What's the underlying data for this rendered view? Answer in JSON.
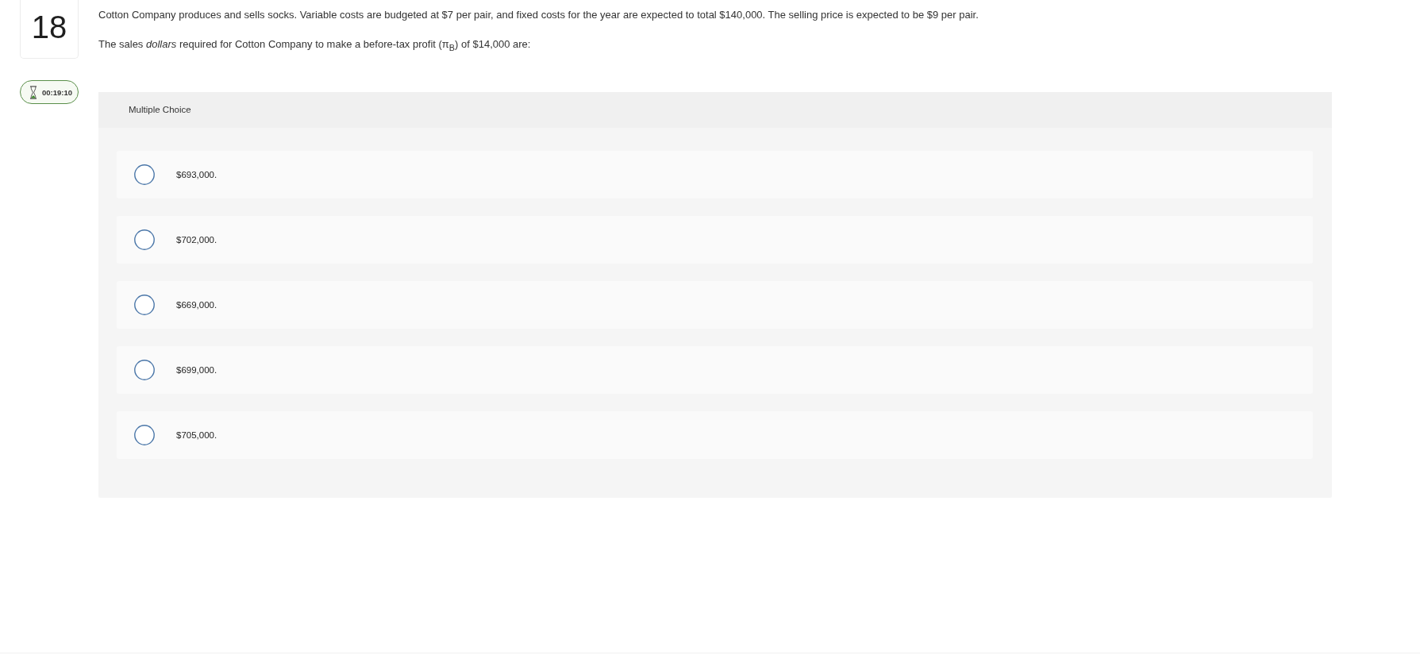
{
  "question": {
    "number": "18",
    "timer": "00:19:10",
    "paragraphs": [
      "Cotton Company produces and sells socks. Variable costs are budgeted at $7 per pair, and fixed costs for the year are expected to total $140,000. The selling price is expected to be $9 per pair.",
      "The sales *dollars* required for Cotton Company to make a before-tax profit (π$_{B}$) of $14,000 are:"
    ]
  },
  "answer_panel": {
    "title": "Multiple Choice",
    "options": [
      {
        "label": "$693,000.",
        "selected": false
      },
      {
        "label": "$702,000.",
        "selected": false
      },
      {
        "label": "$669,000.",
        "selected": false
      },
      {
        "label": "$699,000.",
        "selected": false
      },
      {
        "label": "$705,000.",
        "selected": false
      }
    ]
  }
}
